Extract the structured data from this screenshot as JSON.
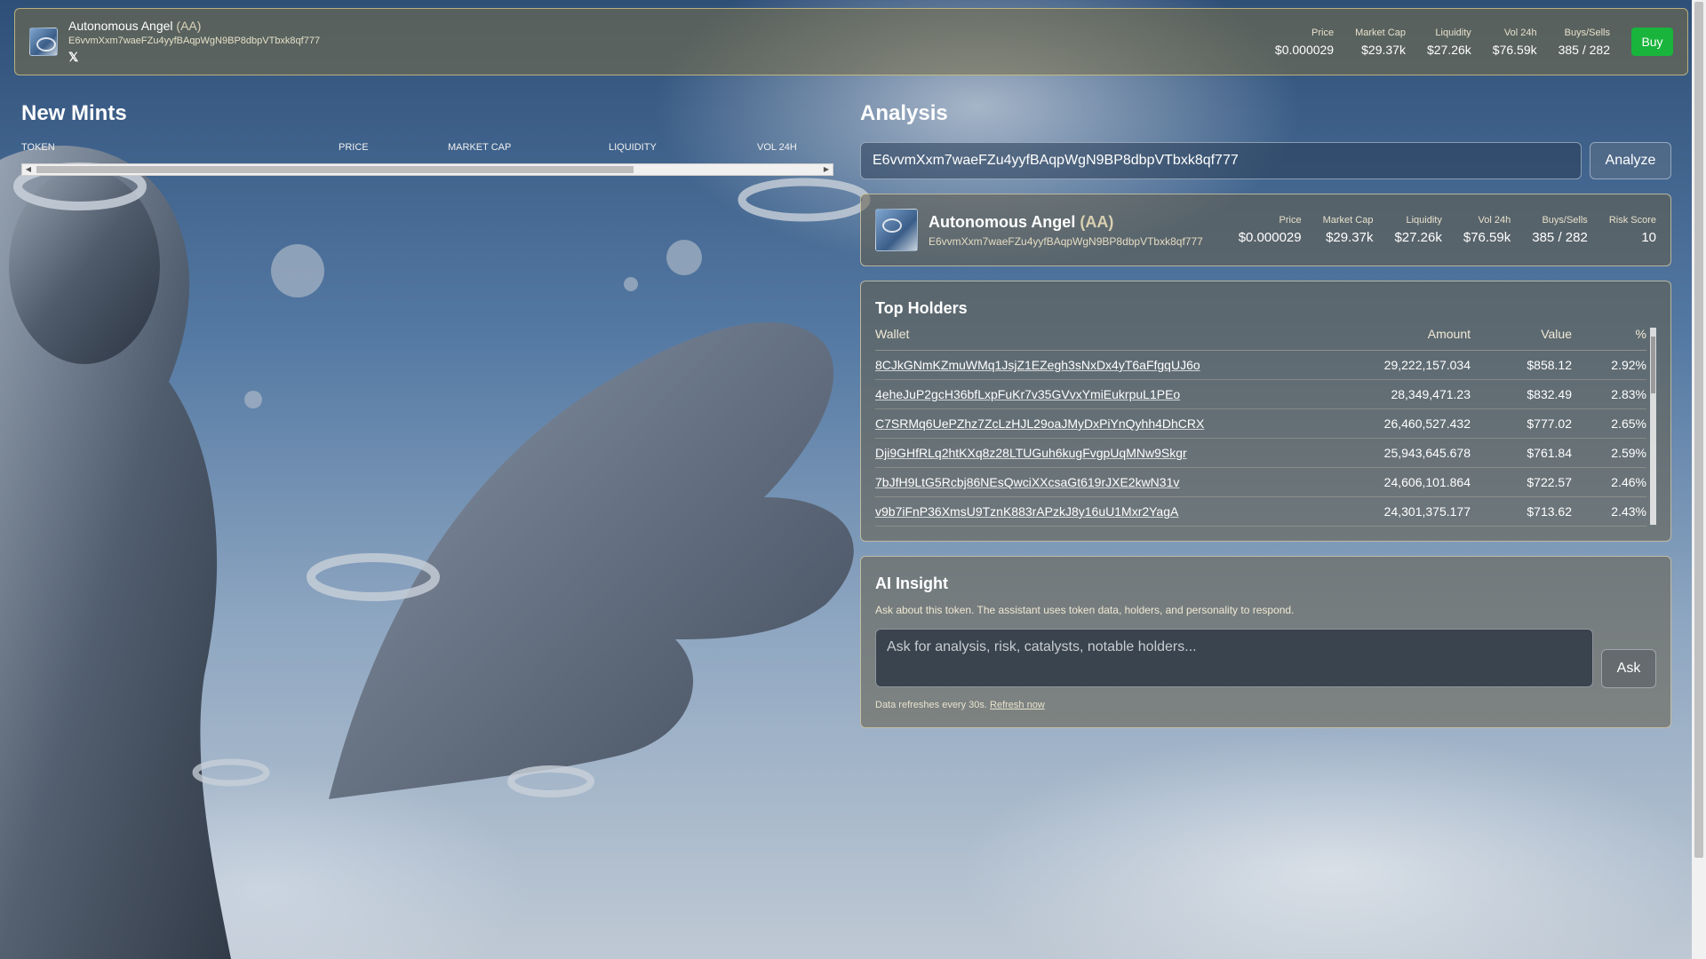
{
  "topbar": {
    "token_name": "Autonomous Angel",
    "token_symbol": "(AA)",
    "address": "E6vvmXxm7waeFZu4yyfBAqpWgN9BP8dbpVTbxk8qf777",
    "x_link": "𝕏",
    "stats": [
      {
        "label": "Price",
        "value": "$0.000029"
      },
      {
        "label": "Market Cap",
        "value": "$29.37k"
      },
      {
        "label": "Liquidity",
        "value": "$27.26k"
      },
      {
        "label": "Vol 24h",
        "value": "$76.59k"
      },
      {
        "label": "Buys/Sells",
        "value": "385 / 282"
      }
    ],
    "buy_label": "Buy",
    "buy_color": "#19b43c"
  },
  "mints": {
    "title": "New Mints",
    "columns": [
      "TOKEN",
      "PRICE",
      "MARKET CAP",
      "LIQUIDITY",
      "VOL 24H"
    ]
  },
  "analysis": {
    "title": "Analysis",
    "input_value": "E6vvmXxm7waeFZu4yyfBAqpWgN9BP8dbpVTbxk8qf777",
    "analyze_label": "Analyze",
    "token": {
      "name": "Autonomous Angel",
      "symbol": "(AA)",
      "address": "E6vvmXxm7waeFZu4yyfBAqpWgN9BP8dbpVTbxk8qf777",
      "stats": [
        {
          "label": "Price",
          "value": "$0.000029"
        },
        {
          "label": "Market Cap",
          "value": "$29.37k"
        },
        {
          "label": "Liquidity",
          "value": "$27.26k"
        },
        {
          "label": "Vol 24h",
          "value": "$76.59k"
        },
        {
          "label": "Buys/Sells",
          "value": "385 / 282"
        },
        {
          "label": "Risk Score",
          "value": "10"
        }
      ]
    }
  },
  "holders": {
    "title": "Top Holders",
    "columns": {
      "wallet": "Wallet",
      "amount": "Amount",
      "value": "Value",
      "pct": "%"
    },
    "rows": [
      {
        "wallet": "8CJkGNmKZmuWMq1JsjZ1EZegh3sNxDx4yT6aFfgqUJ6o",
        "amount": "29,222,157.034",
        "value": "$858.12",
        "pct": "2.92%"
      },
      {
        "wallet": "4eheJuP2gcH36bfLxpFuKr7v35GVvxYmiEukrpuL1PEo",
        "amount": "28,349,471.23",
        "value": "$832.49",
        "pct": "2.83%"
      },
      {
        "wallet": "C7SRMq6UePZhz7ZcLzHJL29oaJMyDxPiYnQyhh4DhCRX",
        "amount": "26,460,527.432",
        "value": "$777.02",
        "pct": "2.65%"
      },
      {
        "wallet": "Dji9GHfRLq2htKXq8z28LTUGuh6kugFvgpUqMNw9Skgr",
        "amount": "25,943,645.678",
        "value": "$761.84",
        "pct": "2.59%"
      },
      {
        "wallet": "7bJfH9LtG5Rcbj86NEsQwciXXcsaGt619rJXE2kwN31v",
        "amount": "24,606,101.864",
        "value": "$722.57",
        "pct": "2.46%"
      },
      {
        "wallet": "v9b7iFnP36XmsU9TznK883rAPzkJ8y16uU1Mxr2YagA",
        "amount": "24,301,375.177",
        "value": "$713.62",
        "pct": "2.43%"
      }
    ]
  },
  "insight": {
    "title": "AI Insight",
    "description": "Ask about this token. The assistant uses token data, holders, and personality to respond.",
    "placeholder": "Ask for analysis, risk, catalysts, notable holders...",
    "ask_label": "Ask",
    "footer_text": "Data refreshes every 30s.",
    "refresh_label": "Refresh now"
  }
}
